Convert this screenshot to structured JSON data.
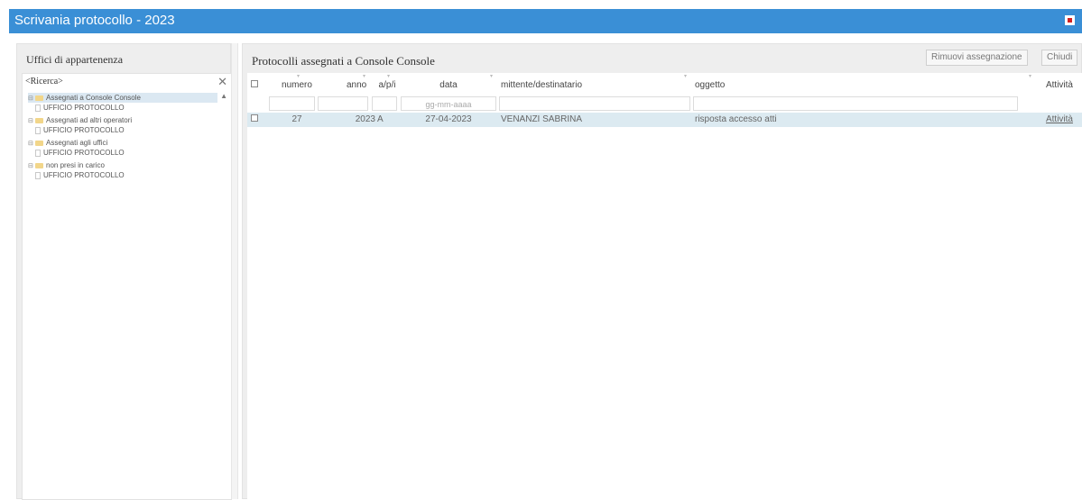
{
  "window": {
    "title": "Scrivania protocollo - 2023"
  },
  "left": {
    "header": "Uffici di appartenenza",
    "search_text": "<Ricerca>",
    "tree": [
      {
        "label": "Assegnati a Console Console",
        "kind": "folder",
        "selected": true
      },
      {
        "label": "UFFICIO PROTOCOLLO",
        "kind": "doc"
      },
      {
        "label": "Assegnati ad altri operatori",
        "kind": "folder"
      },
      {
        "label": "UFFICIO PROTOCOLLO",
        "kind": "doc"
      },
      {
        "label": "Assegnati agli uffici",
        "kind": "folder"
      },
      {
        "label": "UFFICIO PROTOCOLLO",
        "kind": "doc"
      },
      {
        "label": "non presi in carico",
        "kind": "folder"
      },
      {
        "label": "UFFICIO PROTOCOLLO",
        "kind": "doc"
      }
    ]
  },
  "right": {
    "header": "Protocolli assegnati a Console Console",
    "remove_button": "Rimuovi assegnazione",
    "close_button": "Chiudi",
    "columns": {
      "numero": "numero",
      "anno": "anno",
      "arpi": "a/p/i",
      "data": "data",
      "mittente": "mittente/destinatario",
      "oggetto": "oggetto",
      "attivita": "Attività"
    },
    "filter_date_placeholder": "gg-mm-aaaa",
    "rows": [
      {
        "numero": "27",
        "anno": "2023",
        "arpi": "A",
        "data": "27-04-2023",
        "mittente": "VENANZI SABRINA",
        "oggetto": "risposta accesso atti",
        "attivita": "Attività"
      }
    ]
  },
  "colors": {
    "titlebar": "#3a8fd6",
    "selected_row": "#dceaf1",
    "link": "#3a7fd0"
  }
}
